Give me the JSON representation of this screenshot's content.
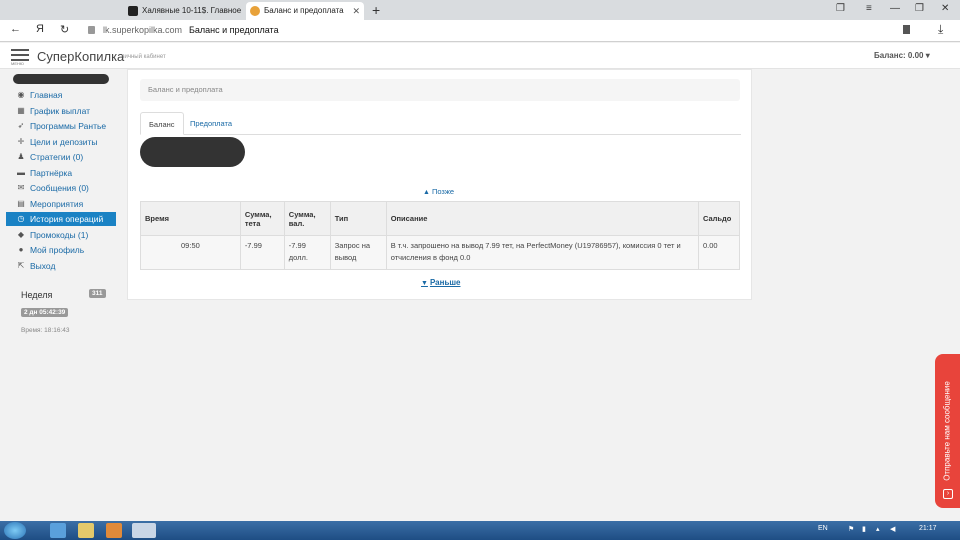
{
  "browser": {
    "tabs": [
      {
        "title": "Халявные 10-11$. Главное"
      },
      {
        "title": "Баланс и предоплата"
      }
    ],
    "new_tab": "+",
    "address": {
      "domain": "lk.superkopilka.com",
      "page_title": "Баланс и предоплата"
    },
    "nav": {
      "back": "←",
      "yandex": "Я",
      "reload": "↻"
    }
  },
  "header": {
    "menu_caption": "МЕНЮ",
    "brand": "СуперКопилка",
    "brand_sub": "личный кабинет",
    "balance": "Баланс: 0.00 ▾"
  },
  "sidebar": {
    "items": [
      {
        "label": "Главная",
        "icon": "dashboard-icon",
        "glyph": "◉"
      },
      {
        "label": "График выплат",
        "icon": "calendar-icon",
        "glyph": "▦"
      },
      {
        "label": "Программы Рантье",
        "icon": "rocket-icon",
        "glyph": "➶"
      },
      {
        "label": "Цели и депозиты",
        "icon": "crosshair-icon",
        "glyph": "✛"
      },
      {
        "label": "Стратегии (0)",
        "icon": "strategy-icon",
        "glyph": "♟"
      },
      {
        "label": "Партнёрка",
        "icon": "briefcase-icon",
        "glyph": "▬"
      },
      {
        "label": "Сообщения (0)",
        "icon": "envelope-icon",
        "glyph": "✉"
      },
      {
        "label": "Мероприятия",
        "icon": "film-icon",
        "glyph": "▤"
      },
      {
        "label": "История операций",
        "icon": "clock-icon",
        "glyph": "◷",
        "active": true
      },
      {
        "label": "Промокоды (1)",
        "icon": "tag-icon",
        "glyph": "◆"
      },
      {
        "label": "Мой профиль",
        "icon": "user-icon",
        "glyph": "●"
      },
      {
        "label": "Выход",
        "icon": "exit-icon",
        "glyph": "⇱"
      }
    ],
    "week_label": "Неделя",
    "week_badge": "311",
    "timer": "2 дн 05:42:39",
    "time": "Время: 18:16:43"
  },
  "main": {
    "breadcrumb": "Баланс и предоплата",
    "tabs": [
      {
        "label": "Баланс"
      },
      {
        "label": "Предоплата"
      }
    ],
    "later": "Позже",
    "earlier": "Раньше",
    "table": {
      "headers": [
        "Время",
        "Сумма, тета",
        "Сумма, вал.",
        "Тип",
        "Описание",
        "Сальдо"
      ],
      "rows": [
        {
          "time": "09:50",
          "sum_teta": "-7.99",
          "sum_val": "-7.99 долл.",
          "type": "Запрос на вывод",
          "desc": "В т.ч. запрошено на вывод 7.99 тет, на PerfectMoney (U19786957), комиссия 0 тет и отчисления в фонд 0.0",
          "saldo": "0.00"
        }
      ]
    }
  },
  "feedback": {
    "label": "Отправьте нам сообщение"
  },
  "taskbar": {
    "lang": "EN",
    "clock": "21:17"
  },
  "colors": {
    "accent": "#1a82c4",
    "link": "#1a6aa6",
    "feedback": "#e8443b"
  }
}
